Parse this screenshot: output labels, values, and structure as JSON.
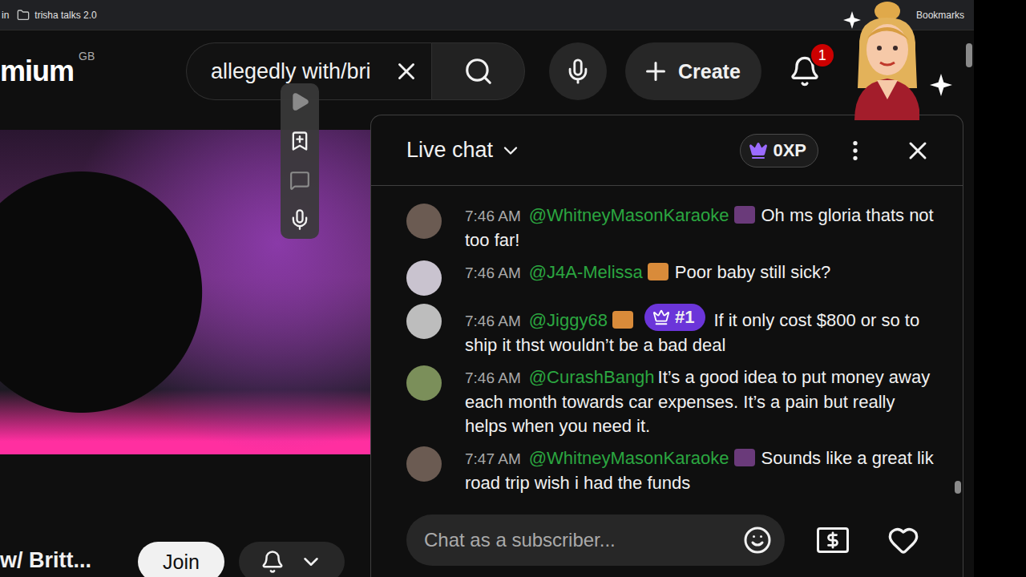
{
  "bookmarks_bar": {
    "items": [
      {
        "label": "in",
        "kind": "link"
      },
      {
        "label": "trisha talks 2.0",
        "kind": "folder"
      }
    ],
    "bookmarks": "Bookmarks"
  },
  "header": {
    "logo": "mium",
    "region": "GB",
    "search": {
      "value": "allegedly with/bri"
    },
    "create": "Create",
    "notifications": "1"
  },
  "video": {
    "title": "w/ Britt...",
    "join": "Join"
  },
  "chat": {
    "title": "Live chat",
    "xp": "0XP",
    "messages": [
      {
        "time": "7:46 AM",
        "author": "@WhitneyMasonKaraoke",
        "badge": true,
        "rank": "",
        "text": "Oh ms gloria thats not too far!"
      },
      {
        "time": "7:46 AM",
        "author": "@J4A-Melissa",
        "badge": true,
        "rank": "",
        "text": "Poor baby still sick?"
      },
      {
        "time": "7:46 AM",
        "author": "@Jiggy68",
        "badge": true,
        "rank": "#1",
        "text": "If it only cost $800 or so to ship it thst wouldn’t be a bad deal"
      },
      {
        "time": "7:46 AM",
        "author": "@CurashBangh",
        "badge": false,
        "rank": "",
        "text": "It’s a good idea to put money away each month towards car expenses. It’s a pain but really helps when you need it."
      },
      {
        "time": "7:47 AM",
        "author": "@WhitneyMasonKaraoke",
        "badge": true,
        "rank": "",
        "text": "Sounds like a great lik road trip wish i had the funds"
      }
    ],
    "input": {
      "placeholder": "Chat as a subscriber..."
    }
  }
}
